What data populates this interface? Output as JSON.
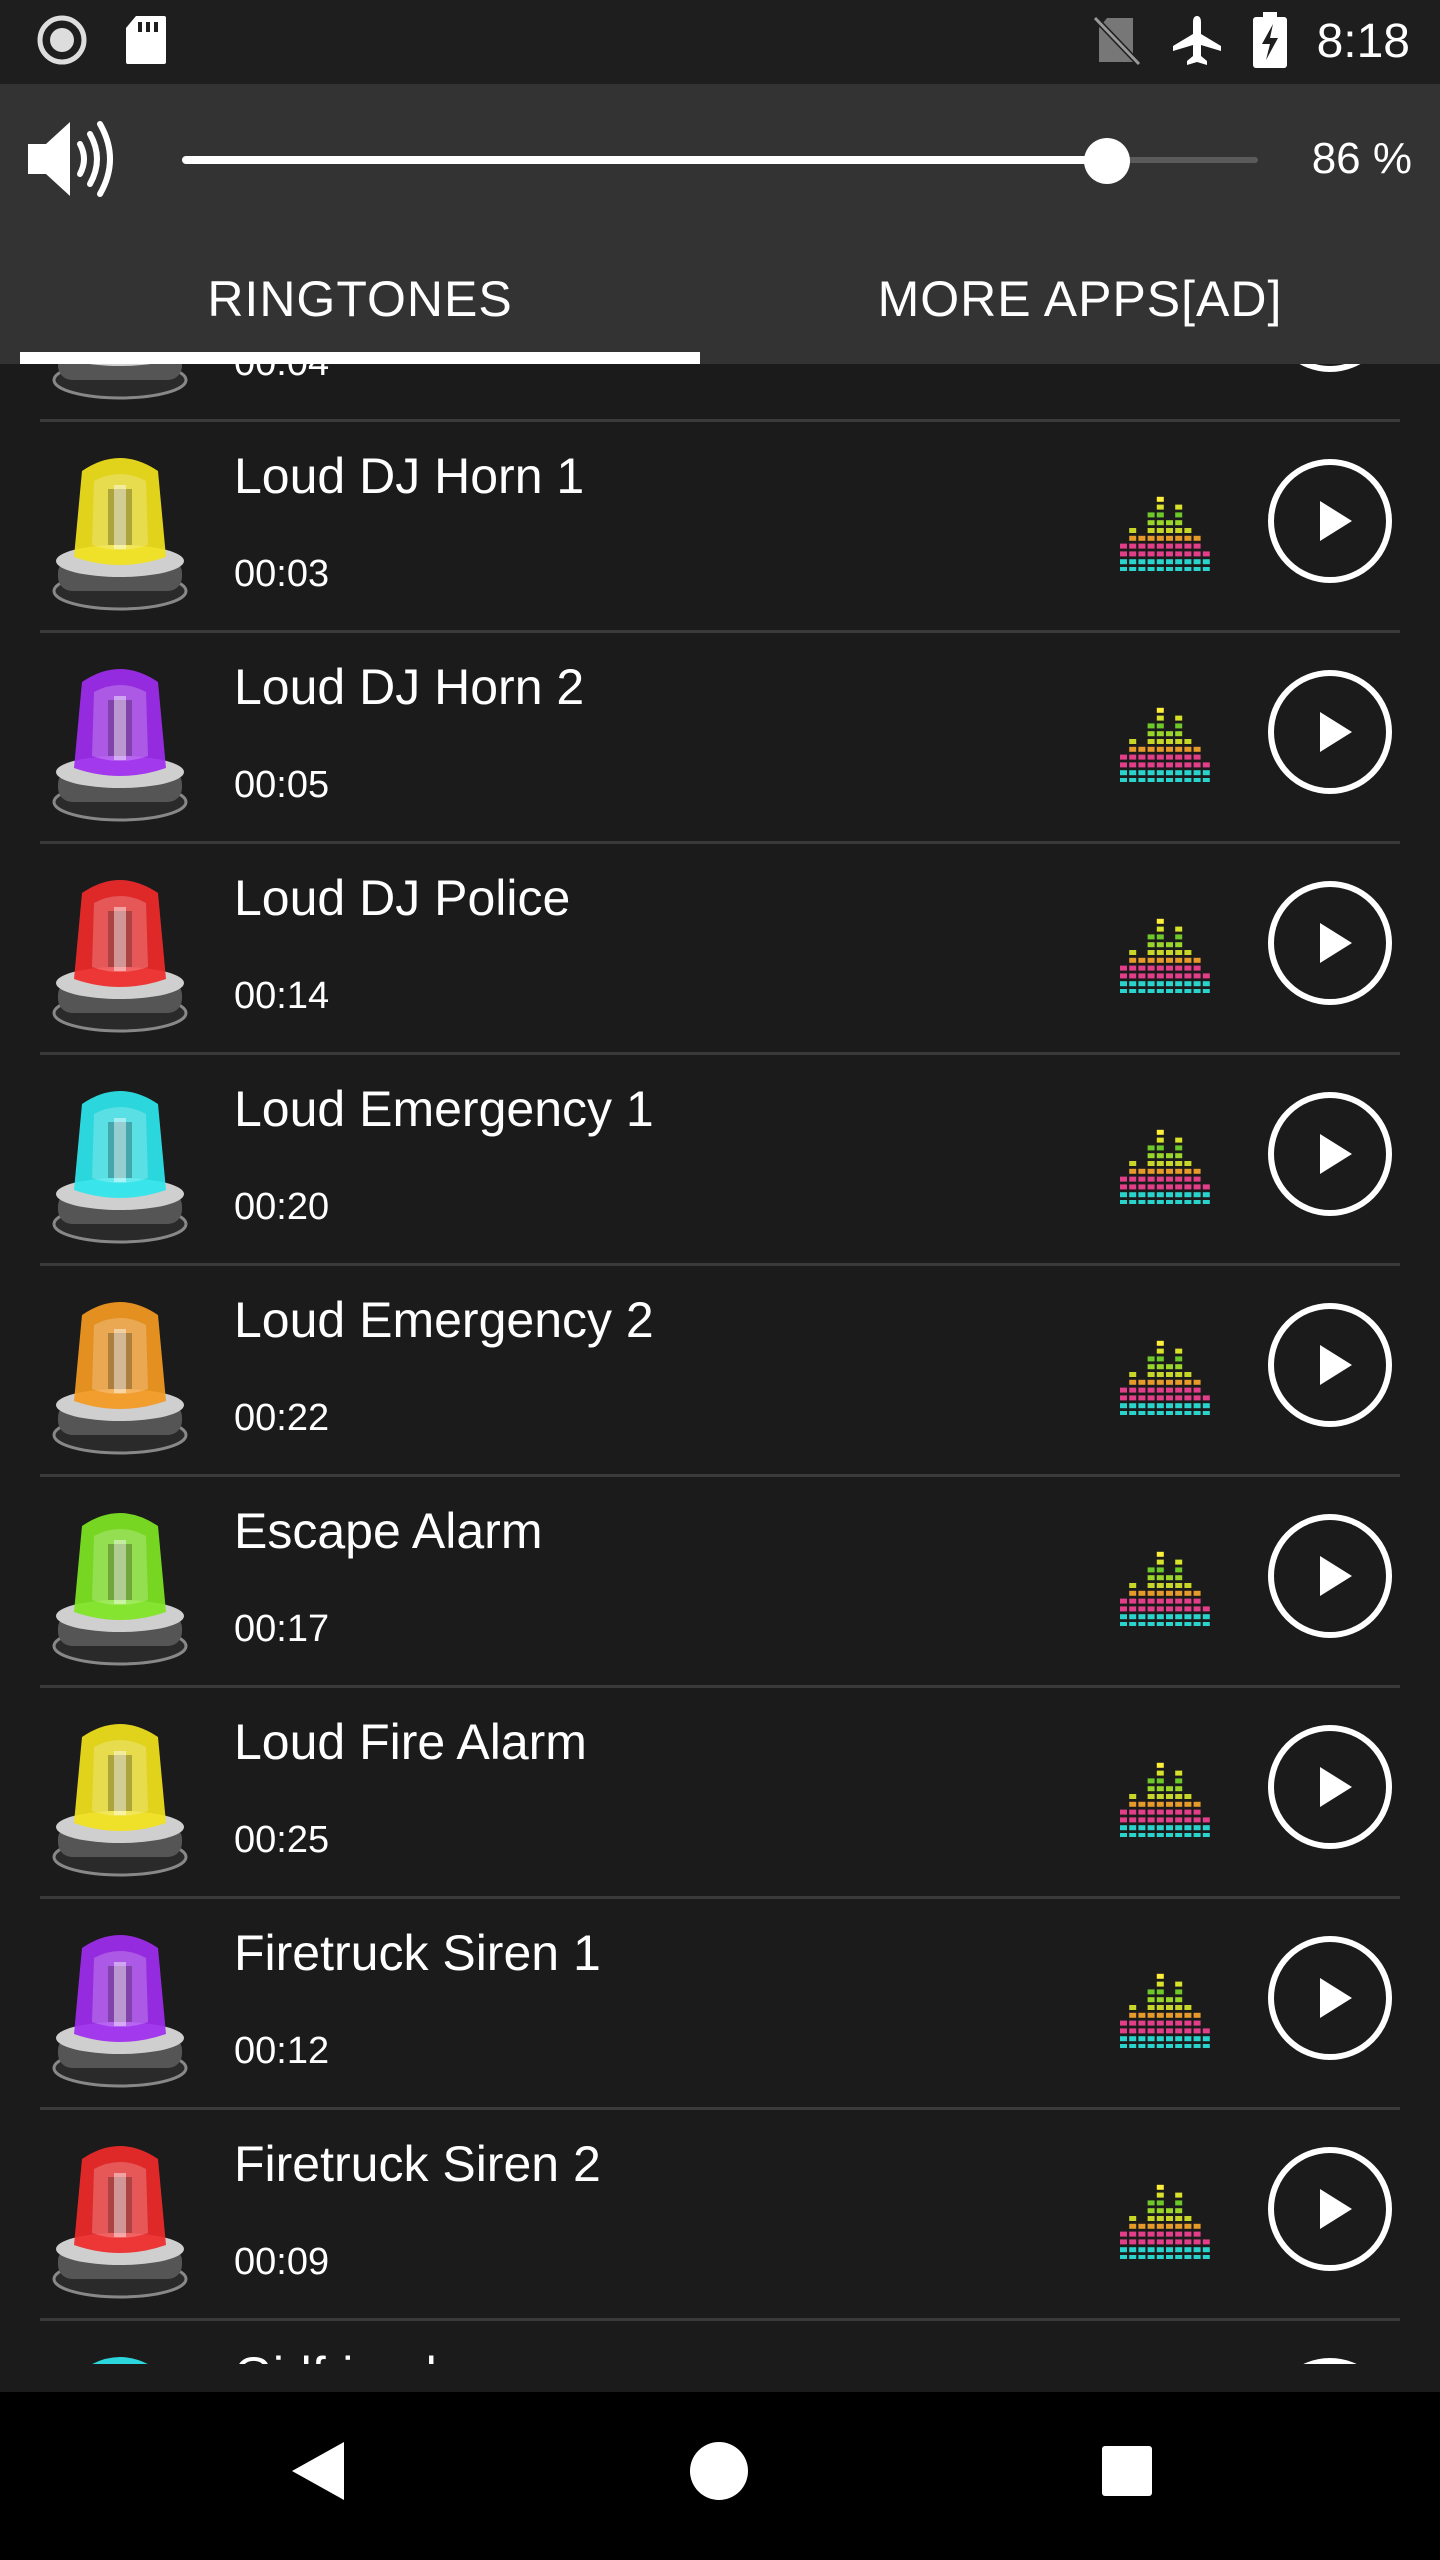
{
  "status_bar": {
    "time": "8:18",
    "icons_left": [
      "record-icon",
      "sd-card-icon"
    ],
    "icons_right": [
      "no-sim-icon",
      "airplane-icon",
      "battery-charging-icon"
    ]
  },
  "volume": {
    "percent_label": "86 %",
    "level": 0.86
  },
  "tabs": [
    {
      "label": "RINGTONES",
      "selected": true
    },
    {
      "label": "MORE APPS[AD]",
      "selected": false
    }
  ],
  "ringtones": [
    {
      "title": "",
      "duration": "00:04",
      "color": "#9a9a9a"
    },
    {
      "title": "Loud DJ Horn 1",
      "duration": "00:03",
      "color": "#f2e21c"
    },
    {
      "title": "Loud DJ Horn 2",
      "duration": "00:05",
      "color": "#a02cf0"
    },
    {
      "title": "Loud DJ Police",
      "duration": "00:14",
      "color": "#f02a2a"
    },
    {
      "title": "Loud Emergency 1",
      "duration": "00:20",
      "color": "#2ee6ee"
    },
    {
      "title": "Loud Emergency 2",
      "duration": "00:22",
      "color": "#f49a22"
    },
    {
      "title": "Escape Alarm",
      "duration": "00:17",
      "color": "#7ee622"
    },
    {
      "title": "Loud Fire Alarm",
      "duration": "00:25",
      "color": "#f2e21c"
    },
    {
      "title": "Firetruck Siren 1",
      "duration": "00:12",
      "color": "#a02cf0"
    },
    {
      "title": "Firetruck Siren 2",
      "duration": "00:09",
      "color": "#f02a2a"
    },
    {
      "title": "Girlfriend",
      "duration": "",
      "color": "#2ee6ee"
    }
  ],
  "nav": {
    "icons": [
      "back-icon",
      "home-icon",
      "recents-icon"
    ]
  }
}
